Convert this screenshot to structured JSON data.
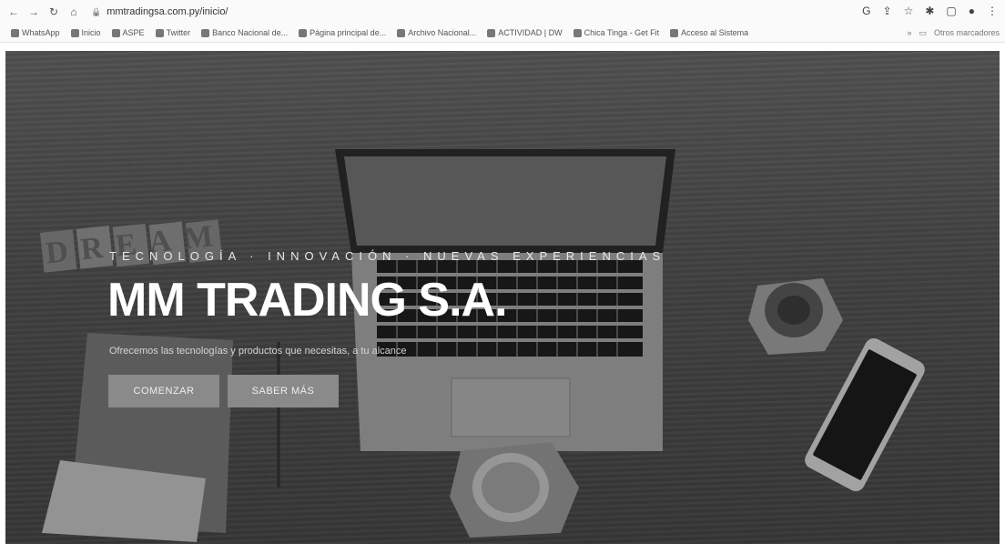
{
  "browser": {
    "url": "mmtradingsa.com.py/inicio/",
    "bookmarks": [
      {
        "label": "WhatsApp"
      },
      {
        "label": "Inicio"
      },
      {
        "label": "ASPE"
      },
      {
        "label": "Twitter"
      },
      {
        "label": "Banco Nacional de..."
      },
      {
        "label": "Página principal de..."
      },
      {
        "label": "Archivo Nacional..."
      },
      {
        "label": "ACTIVIDAD | DW"
      },
      {
        "label": "Chica Tinga - Get Fit"
      },
      {
        "label": "Acceso al Sistema"
      }
    ],
    "right_bookmark": "Otros marcadores"
  },
  "hero": {
    "tagline": "TECNOLOGÍA · INNOVACIÓN · NUEVAS EXPERIENCIAS",
    "title": "MM TRADING S.A.",
    "subtitle": "Ofrecemos las tecnologías y productos que necesitas, a tu alcance",
    "buttons": {
      "primary": "COMENZAR",
      "secondary": "SABER MÁS"
    },
    "background_word": "DREAM"
  },
  "colors": {
    "title": "#ffffff",
    "button_bg": "#8a8a8a",
    "wood": "#5a5a5a"
  }
}
